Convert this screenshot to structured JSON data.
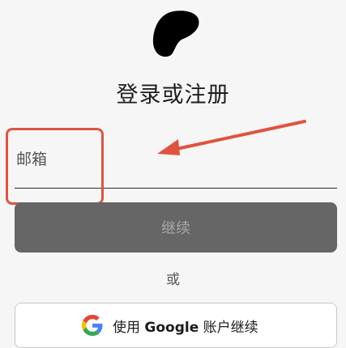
{
  "auth": {
    "title": "登录或注册",
    "email_placeholder": "邮箱",
    "continue_label": "继续",
    "or_label": "或",
    "google_button": {
      "prefix": "使用",
      "brand": "Google",
      "suffix": "账户继续"
    }
  },
  "icons": {
    "logo": "brand-logo",
    "google": "google-icon"
  },
  "colors": {
    "background": "#f6f6f6",
    "continue_button_bg": "#666666",
    "continue_button_text": "#a8a8a8",
    "annotation_red": "#e0533f"
  }
}
